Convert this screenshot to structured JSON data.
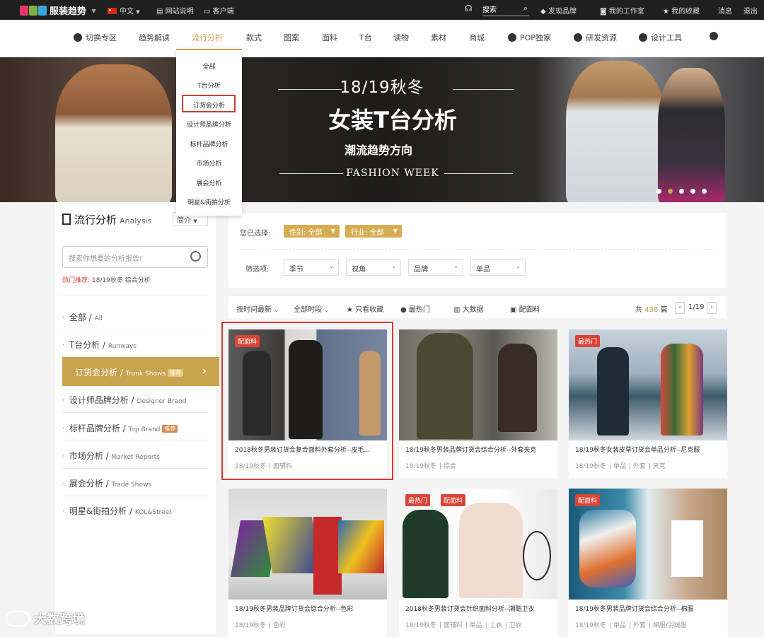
{
  "topbar": {
    "logo_text": "服装趋势",
    "logo_letters": "POP",
    "language": "中文",
    "site_help": "网站说明",
    "client": "客户端",
    "search": "搜索",
    "discover_brand": "发现品牌",
    "my_workspace": "我的工作室",
    "my_favorites": "我的收藏",
    "messages": "消息",
    "logout": "退出"
  },
  "nav": {
    "switch": "切换专区",
    "items": [
      "趋势解读",
      "流行分析",
      "款式",
      "图案",
      "面料",
      "T台",
      "读物",
      "素材",
      "商城"
    ],
    "pop_exclusive": "POP独家",
    "rd_resources": "研发资源",
    "design_tools": "设计工具"
  },
  "dropdown": {
    "items": [
      "全部",
      "T台分析",
      "订货会分析",
      "设计师品牌分析",
      "标杆品牌分析",
      "市场分析",
      "展会分析",
      "明星&街拍分析"
    ]
  },
  "banner": {
    "season": "18/19秋冬",
    "headline": "女装T台分析",
    "subtitle": "潮流趋势方向",
    "event": "FASHION WEEK",
    "slides": 5,
    "active_slide": 2
  },
  "sidebar": {
    "title": "流行分析",
    "title_en": "Analysis",
    "select_value": "简介",
    "search_placeholder": "搜索你想要的分析报告!",
    "hot_label": "热门推荐:",
    "hot_value": "18/19秋冬 综合分析",
    "menu": [
      {
        "label": "全部",
        "en": "All"
      },
      {
        "label": "T台分析",
        "en": "Runways"
      },
      {
        "label": "订货会分析",
        "en": "Trunk Shows",
        "tag": "推荐"
      },
      {
        "label": "设计师品牌分析",
        "en": "Designer Brand"
      },
      {
        "label": "标杆品牌分析",
        "en": "Top Brand",
        "tag": "推荐"
      },
      {
        "label": "市场分析",
        "en": "Market Reports"
      },
      {
        "label": "展会分析",
        "en": "Trade Shows"
      },
      {
        "label": "明星&街拍分析",
        "en": "KOL&Street"
      }
    ]
  },
  "filters": {
    "selected_label": "您已选择:",
    "chips": [
      "性别: 全部",
      "行业: 全部"
    ],
    "filter_label": "筛选项:",
    "selects": [
      "季节",
      "视角",
      "品牌",
      "单品"
    ]
  },
  "sortbar": {
    "sort_time": "按时间最新",
    "all_time": "全部时段",
    "only_favorites": "只看收藏",
    "hottest": "最热门",
    "big_data": "大数据",
    "with_fabric": "配面料",
    "total_prefix": "共",
    "total": "436",
    "total_suffix": "篇",
    "page": "1/19"
  },
  "cards": [
    {
      "badge": "配面料",
      "title": "2018秋冬男装订货会复合面料外套分析--皮毛...",
      "tags": [
        "18/19秋冬",
        "面辅料"
      ]
    },
    {
      "badge": "",
      "title": "18/19秋冬男装品牌订货会综合分析--外套夹克",
      "tags": [
        "18/19秋冬",
        "综合"
      ]
    },
    {
      "badge": "最热门",
      "title": "18/19秋冬女装皮草订货会单品分析--尼克服",
      "tags": [
        "18/19秋冬",
        "单品",
        "外套",
        "夹克"
      ]
    },
    {
      "badge": "",
      "title": "18/19秋冬男装品牌订货会综合分析--色彩",
      "tags": [
        "18/19秋冬",
        "色彩"
      ]
    },
    {
      "badges": [
        "最热门",
        "配面料"
      ],
      "title": "2018秋冬男装订货会针织面料分析--潮酷卫衣",
      "tags": [
        "18/19秋冬",
        "面辅料",
        "单品",
        "上衣",
        "卫衣"
      ]
    },
    {
      "badge": "配面料",
      "title": "18/19秋冬男装品牌订货会综合分析--棉服",
      "tags": [
        "18/19秋冬",
        "单品",
        "外套",
        "棉服/羽绒服"
      ]
    }
  ],
  "watermark": "大数跨境"
}
